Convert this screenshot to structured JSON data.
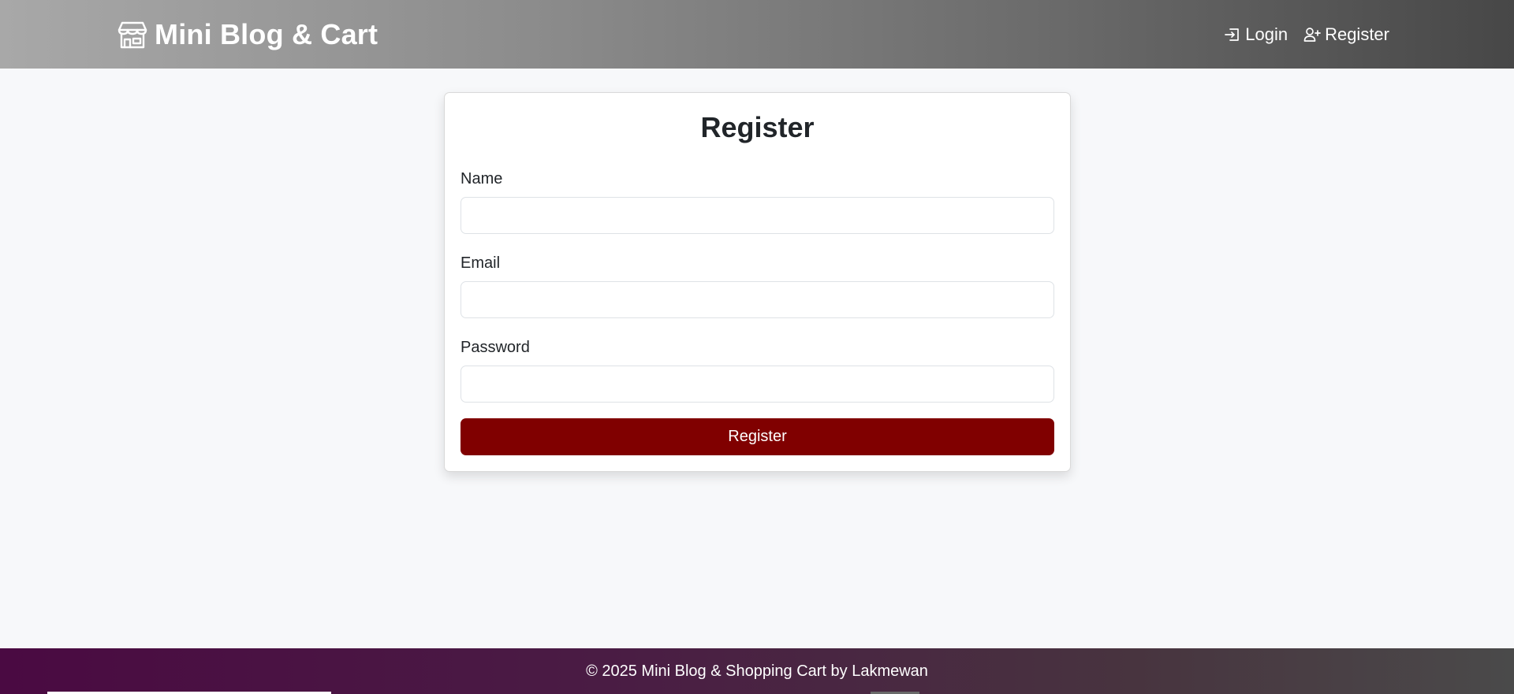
{
  "header": {
    "brand": "Mini Blog & Cart",
    "nav": {
      "login_label": "Login",
      "register_label": "Register"
    }
  },
  "register_form": {
    "title": "Register",
    "fields": {
      "name": {
        "label": "Name",
        "value": "",
        "placeholder": ""
      },
      "email": {
        "label": "Email",
        "value": "",
        "placeholder": ""
      },
      "password": {
        "label": "Password",
        "value": "",
        "placeholder": ""
      }
    },
    "submit_label": "Register"
  },
  "footer": {
    "text": "© 2025 Mini Blog & Shopping Cart by Lakmewan"
  },
  "colors": {
    "accent_button": "#800000",
    "header_gradient_start": "#a8a8a8",
    "header_gradient_end": "#474747",
    "footer_gradient_start": "#4a0a42",
    "footer_gradient_end": "#4a4a4a",
    "page_background": "#f7f8fa"
  },
  "icons": {
    "brand": "shop-icon",
    "login": "login-icon",
    "register": "person-add-icon"
  }
}
